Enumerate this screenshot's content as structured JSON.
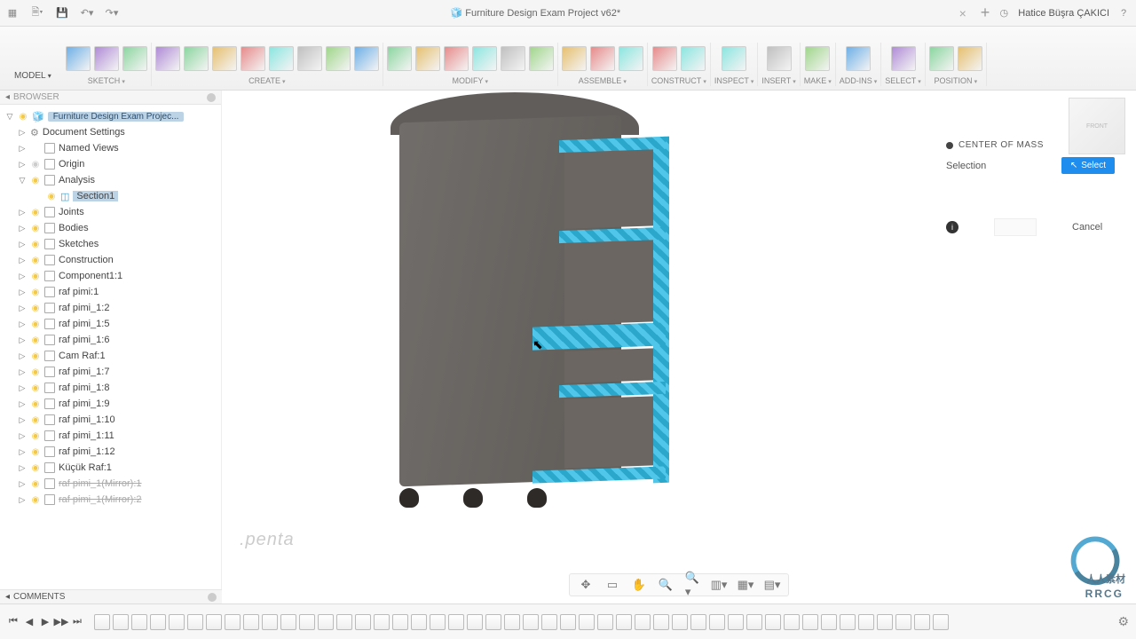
{
  "title": "Furniture Design Exam Project v62*",
  "user": "Hatice Büşra ÇAKICI",
  "ribbon": {
    "model": "MODEL",
    "groups": [
      {
        "label": "SKETCH",
        "drop": true,
        "icons": 3
      },
      {
        "label": "CREATE",
        "drop": true,
        "icons": 8
      },
      {
        "label": "MODIFY",
        "drop": true,
        "icons": 6
      },
      {
        "label": "ASSEMBLE",
        "drop": true,
        "icons": 3
      },
      {
        "label": "CONSTRUCT",
        "drop": true,
        "icons": 2
      },
      {
        "label": "INSPECT",
        "drop": true,
        "icons": 1
      },
      {
        "label": "INSERT",
        "drop": true,
        "icons": 1
      },
      {
        "label": "MAKE",
        "drop": true,
        "icons": 1
      },
      {
        "label": "ADD-INS",
        "drop": true,
        "icons": 1
      },
      {
        "label": "SELECT",
        "drop": true,
        "icons": 1
      },
      {
        "label": "POSITION",
        "drop": true,
        "icons": 2
      }
    ]
  },
  "browser": {
    "title": "BROWSER",
    "root": "Furniture Design Exam Projec...",
    "items": [
      {
        "label": "Document Settings",
        "exp": "▷",
        "depth": 1,
        "icon": "gear"
      },
      {
        "label": "Named Views",
        "exp": "▷",
        "depth": 1,
        "icon": "folder"
      },
      {
        "label": "Origin",
        "exp": "▷",
        "depth": 1,
        "bulb": "off",
        "icon": "folder"
      },
      {
        "label": "Analysis",
        "exp": "▽",
        "depth": 1,
        "bulb": "on",
        "icon": "folder"
      },
      {
        "label": "Section1",
        "exp": "",
        "depth": 2,
        "bulb": "on",
        "icon": "section",
        "sel": true
      },
      {
        "label": "Joints",
        "exp": "▷",
        "depth": 1,
        "bulb": "on",
        "icon": "folder"
      },
      {
        "label": "Bodies",
        "exp": "▷",
        "depth": 1,
        "bulb": "on",
        "icon": "folder"
      },
      {
        "label": "Sketches",
        "exp": "▷",
        "depth": 1,
        "bulb": "on",
        "icon": "folder"
      },
      {
        "label": "Construction",
        "exp": "▷",
        "depth": 1,
        "bulb": "on",
        "icon": "folder"
      },
      {
        "label": "Component1:1",
        "exp": "▷",
        "depth": 1,
        "bulb": "on",
        "icon": "comp"
      },
      {
        "label": "raf pimi:1",
        "exp": "▷",
        "depth": 1,
        "bulb": "on",
        "icon": "comp"
      },
      {
        "label": "raf pimi_1:2",
        "exp": "▷",
        "depth": 1,
        "bulb": "on",
        "icon": "comp"
      },
      {
        "label": "raf pimi_1:5",
        "exp": "▷",
        "depth": 1,
        "bulb": "on",
        "icon": "comp"
      },
      {
        "label": "raf pimi_1:6",
        "exp": "▷",
        "depth": 1,
        "bulb": "on",
        "icon": "comp"
      },
      {
        "label": "Cam Raf:1",
        "exp": "▷",
        "depth": 1,
        "bulb": "on",
        "icon": "comp"
      },
      {
        "label": "raf pimi_1:7",
        "exp": "▷",
        "depth": 1,
        "bulb": "on",
        "icon": "comp"
      },
      {
        "label": "raf pimi_1:8",
        "exp": "▷",
        "depth": 1,
        "bulb": "on",
        "icon": "comp"
      },
      {
        "label": "raf pimi_1:9",
        "exp": "▷",
        "depth": 1,
        "bulb": "on",
        "icon": "comp"
      },
      {
        "label": "raf pimi_1:10",
        "exp": "▷",
        "depth": 1,
        "bulb": "on",
        "icon": "comp"
      },
      {
        "label": "raf pimi_1:11",
        "exp": "▷",
        "depth": 1,
        "bulb": "on",
        "icon": "comp"
      },
      {
        "label": "raf pimi_1:12",
        "exp": "▷",
        "depth": 1,
        "bulb": "on",
        "icon": "comp"
      },
      {
        "label": "Küçük Raf:1",
        "exp": "▷",
        "depth": 1,
        "bulb": "on",
        "icon": "comp"
      },
      {
        "label": "raf pimi_1(Mirror):1",
        "exp": "▷",
        "depth": 1,
        "bulb": "on",
        "icon": "comp",
        "strike": true
      },
      {
        "label": "raf pimi_1(Mirror):2",
        "exp": "▷",
        "depth": 1,
        "bulb": "on",
        "icon": "comp",
        "strike": true
      }
    ]
  },
  "comments": "COMMENTS",
  "com_panel": {
    "title": "CENTER OF MASS",
    "row_label": "Selection",
    "select_btn": "Select",
    "cancel": "Cancel"
  },
  "viewcube": {
    "label": "FRONT"
  },
  "timeline": {
    "count": 46
  },
  "watermark": {
    "brand": "RRCG",
    "cn": "人人素材"
  },
  "penta": ".penta"
}
